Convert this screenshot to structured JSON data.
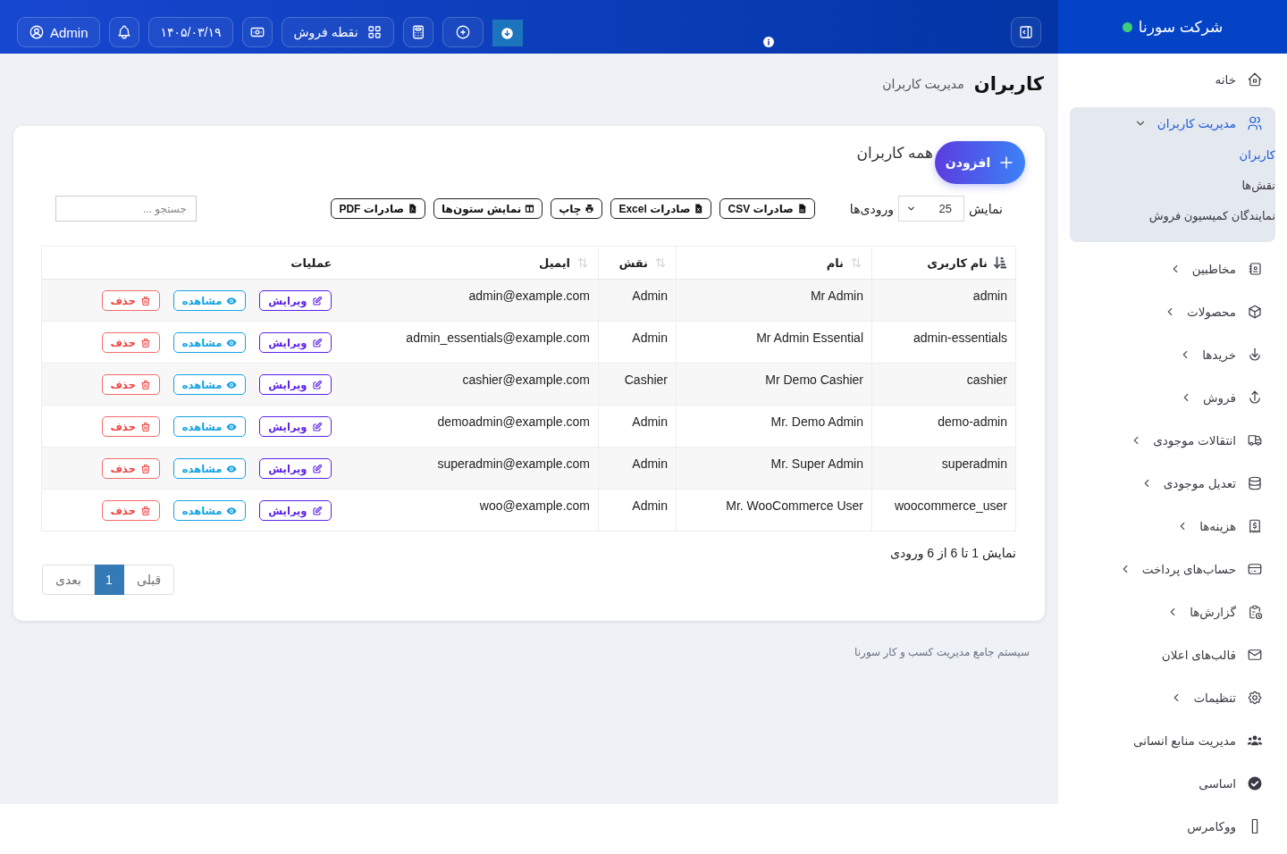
{
  "sidebar": {
    "brand": "شرکت سورنا",
    "items": [
      {
        "label": "خانه",
        "kind": "link",
        "selected": false
      },
      {
        "label": "مدیریت کاربران",
        "kind": "group",
        "selected": true,
        "expanded": true,
        "children": [
          {
            "label": "کاربران",
            "selected": true
          },
          {
            "label": "نقش‌ها",
            "selected": false
          },
          {
            "label": "نمایندگان کمیسیون فروش",
            "selected": false
          }
        ]
      },
      {
        "label": "مخاطبین",
        "kind": "group",
        "selected": false,
        "expanded": false
      },
      {
        "label": "محصولات",
        "kind": "group",
        "selected": false,
        "expanded": false
      },
      {
        "label": "خریدها",
        "kind": "group",
        "selected": false,
        "expanded": false
      },
      {
        "label": "فروش",
        "kind": "group",
        "selected": false,
        "expanded": false
      },
      {
        "label": "انتقالات موجودی",
        "kind": "group",
        "selected": false,
        "expanded": false
      },
      {
        "label": "تعدیل موجودی",
        "kind": "group",
        "selected": false,
        "expanded": false
      },
      {
        "label": "هزینه‌ها",
        "kind": "group",
        "selected": false,
        "expanded": false
      },
      {
        "label": "حساب‌های پرداخت",
        "kind": "group",
        "selected": false,
        "expanded": false
      },
      {
        "label": "گزارش‌ها",
        "kind": "group",
        "selected": false,
        "expanded": false
      },
      {
        "label": "قالب‌های اعلان",
        "kind": "link",
        "selected": false
      },
      {
        "label": "تنظیمات",
        "kind": "group",
        "selected": false,
        "expanded": false
      },
      {
        "label": "مدیریت منابع انسانی",
        "kind": "link",
        "selected": false
      },
      {
        "label": "اساسی",
        "kind": "link",
        "selected": false
      },
      {
        "label": "ووکامرس",
        "kind": "link",
        "selected": false
      }
    ]
  },
  "topbar": {
    "pos_button": "نقطه فروش",
    "date": "۱۴۰۵/۰۳/۱۹",
    "user": "Admin"
  },
  "page_header": {
    "title": "کاربران",
    "subtitle": "مدیریت کاربران"
  },
  "card": {
    "add_button": "افزودن",
    "title": "همه کاربران",
    "length": {
      "show_label": "نمایش",
      "value": "25",
      "entries_label": "ورودی‌ها"
    },
    "export_buttons": [
      {
        "kind": "csv",
        "label": "صادرات CSV"
      },
      {
        "kind": "excel",
        "label": "صادرات Excel"
      },
      {
        "kind": "print",
        "label": "چاپ"
      },
      {
        "kind": "columns",
        "label": "نمایش ستون‌ها"
      },
      {
        "kind": "pdf",
        "label": "صادرات PDF"
      }
    ],
    "search": {
      "placeholder": "جستجو ..."
    },
    "table": {
      "columns": [
        {
          "label": "نام کاربری",
          "sortable": true,
          "sorted": true
        },
        {
          "label": "نام",
          "sortable": true,
          "sorted": false
        },
        {
          "label": "نقش",
          "sortable": true,
          "sorted": false
        },
        {
          "label": "ایمیل",
          "sortable": true,
          "sorted": false
        },
        {
          "label": "عملیات",
          "sortable": false,
          "sorted": false
        }
      ],
      "rows": [
        {
          "cells": [
            "admin",
            "Mr Admin",
            "Admin",
            "admin@example.com"
          ],
          "actions": [
            {
              "kind": "edit",
              "label": "ویرایش"
            },
            {
              "kind": "view",
              "label": "مشاهده"
            },
            {
              "kind": "delete",
              "label": "حذف"
            }
          ]
        },
        {
          "cells": [
            "admin-essentials",
            "Mr Admin Essential",
            "Admin",
            "admin_essentials@example.com"
          ],
          "actions": [
            {
              "kind": "edit",
              "label": "ویرایش"
            },
            {
              "kind": "view",
              "label": "مشاهده"
            },
            {
              "kind": "delete",
              "label": "حذف"
            }
          ]
        },
        {
          "cells": [
            "cashier",
            "Mr Demo Cashier",
            "Cashier",
            "cashier@example.com"
          ],
          "actions": [
            {
              "kind": "edit",
              "label": "ویرایش"
            },
            {
              "kind": "view",
              "label": "مشاهده"
            },
            {
              "kind": "delete",
              "label": "حذف"
            }
          ]
        },
        {
          "cells": [
            "demo-admin",
            "Mr. Demo Admin",
            "Admin",
            "demoadmin@example.com"
          ],
          "actions": [
            {
              "kind": "edit",
              "label": "ویرایش"
            },
            {
              "kind": "view",
              "label": "مشاهده"
            },
            {
              "kind": "delete",
              "label": "حذف"
            }
          ]
        },
        {
          "cells": [
            "superadmin",
            "Mr. Super Admin",
            "Admin",
            "superadmin@example.com"
          ],
          "actions": [
            {
              "kind": "edit",
              "label": "ویرایش"
            },
            {
              "kind": "view",
              "label": "مشاهده"
            },
            {
              "kind": "delete",
              "label": "حذف"
            }
          ]
        },
        {
          "cells": [
            "woocommerce_user",
            "Mr. WooCommerce User",
            "Admin",
            "woo@example.com"
          ],
          "actions": [
            {
              "kind": "edit",
              "label": "ویرایش"
            },
            {
              "kind": "view",
              "label": "مشاهده"
            },
            {
              "kind": "delete",
              "label": "حذف"
            }
          ]
        }
      ]
    },
    "info": "نمایش 1 تا 6 از 6 ورودی",
    "pagination": [
      {
        "label": "قبلی",
        "selected": false,
        "disabled": true
      },
      {
        "label": "1",
        "selected": true,
        "disabled": false
      },
      {
        "label": "بعدی",
        "selected": false,
        "disabled": true
      }
    ]
  },
  "footer": "سیستم جامع مدیریت کسب و کار سورنا"
}
